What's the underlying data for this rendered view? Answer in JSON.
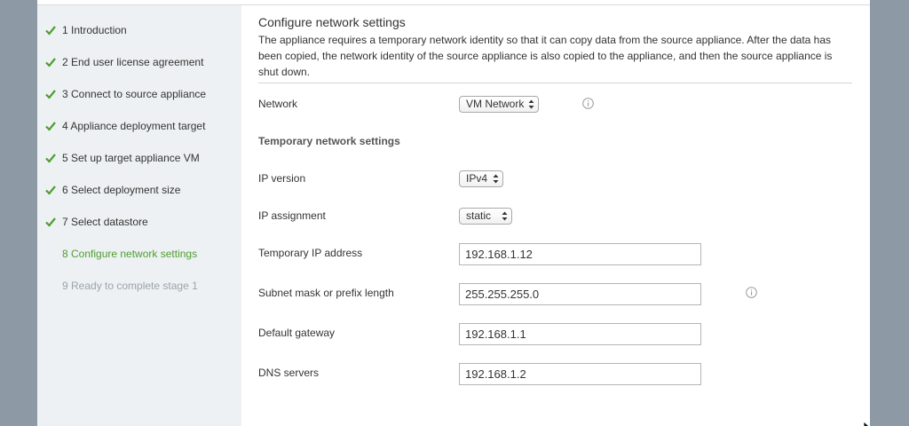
{
  "sidebar": {
    "steps": [
      {
        "label": "1 Introduction",
        "state": "done"
      },
      {
        "label": "2 End user license agreement",
        "state": "done"
      },
      {
        "label": "3 Connect to source appliance",
        "state": "done"
      },
      {
        "label": "4 Appliance deployment target",
        "state": "done"
      },
      {
        "label": "5 Set up target appliance VM",
        "state": "done"
      },
      {
        "label": "6 Select deployment size",
        "state": "done"
      },
      {
        "label": "7 Select datastore",
        "state": "done"
      },
      {
        "label": "8 Configure network settings",
        "state": "current"
      },
      {
        "label": "9 Ready to complete stage 1",
        "state": "future"
      }
    ]
  },
  "main": {
    "title": "Configure network settings",
    "description": "The appliance requires a temporary network identity so that it can copy data from the source appliance. After the data has been copied, the network identity of the source appliance is also copied to the appliance, and then the source appliance is shut down.",
    "network": {
      "label": "Network",
      "value": "VM Network"
    },
    "section_heading": "Temporary network settings",
    "ip_version": {
      "label": "IP version",
      "value": "IPv4"
    },
    "ip_assignment": {
      "label": "IP assignment",
      "value": "static"
    },
    "temp_ip": {
      "label": "Temporary IP address",
      "value": "192.168.1.12"
    },
    "subnet": {
      "label": "Subnet mask or prefix length",
      "value": "255.255.255.0"
    },
    "gateway": {
      "label": "Default gateway",
      "value": "192.168.1.1"
    },
    "dns": {
      "label": "DNS servers",
      "value": "192.168.1.2"
    }
  },
  "colors": {
    "accent_green": "#4d9e2e",
    "sidebar_bg": "#eef1f3",
    "future_step": "#9aa4ad"
  },
  "icons": {
    "check": "check-icon",
    "info": "info-icon",
    "select_arrows": "select-arrows-icon"
  }
}
